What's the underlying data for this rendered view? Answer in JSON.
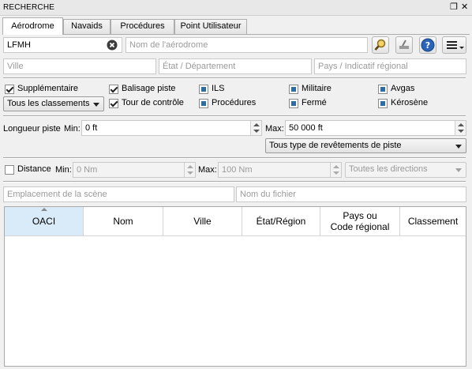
{
  "window": {
    "title": "RECHERCHE"
  },
  "tabs": [
    {
      "label": "Aérodrome"
    },
    {
      "label": "Navaids"
    },
    {
      "label": "Procédures"
    },
    {
      "label": "Point Utilisateur"
    }
  ],
  "search": {
    "icao_value": "LFMH",
    "name_placeholder": "Nom de l'aérodrome",
    "city_placeholder": "Ville",
    "state_placeholder": "État / Département",
    "country_placeholder": "Pays / Indicatif régional"
  },
  "filters": {
    "supplementary": "Supplémentaire",
    "rating_combo": "Tous les classements",
    "runway_lighting": "Balisage piste",
    "control_tower": "Tour de contrôle",
    "ils": "ILS",
    "procedures": "Procédures",
    "military": "Militaire",
    "closed": "Fermé",
    "avgas": "Avgas",
    "kerosene": "Kérosène"
  },
  "runway": {
    "length_label": "Longueur piste",
    "min_label": "Min:",
    "min_value": "0 ft",
    "max_label": "Max:",
    "max_value": "50 000 ft",
    "surface_combo": "Tous type de revêtements de piste"
  },
  "distance": {
    "label": "Distance",
    "min_label": "Min:",
    "min_value": "0 Nm",
    "max_label": "Max:",
    "max_value": "100 Nm",
    "direction_combo": "Toutes les directions"
  },
  "scenery": {
    "location_placeholder": "Emplacement de la scène",
    "file_placeholder": "Nom du fichier"
  },
  "table": {
    "columns": [
      "OACI",
      "Nom",
      "Ville",
      "État/Région",
      "Pays ou Code régional",
      "Classement"
    ],
    "column_lines": [
      [
        "OACI"
      ],
      [
        "Nom"
      ],
      [
        "Ville"
      ],
      [
        "État/Région"
      ],
      [
        "Pays ou",
        "Code régional"
      ],
      [
        "Classement"
      ]
    ]
  },
  "colors": {
    "sorted_header": "#d9ebf9",
    "tristate_fill": "#2b6ea6",
    "help_button": "#2a63b8"
  },
  "icons": [
    "clear-icon",
    "search-icon",
    "reset-icon",
    "help-icon",
    "menu-icon",
    "undock-icon",
    "close-icon",
    "sort-ascending-icon"
  ]
}
